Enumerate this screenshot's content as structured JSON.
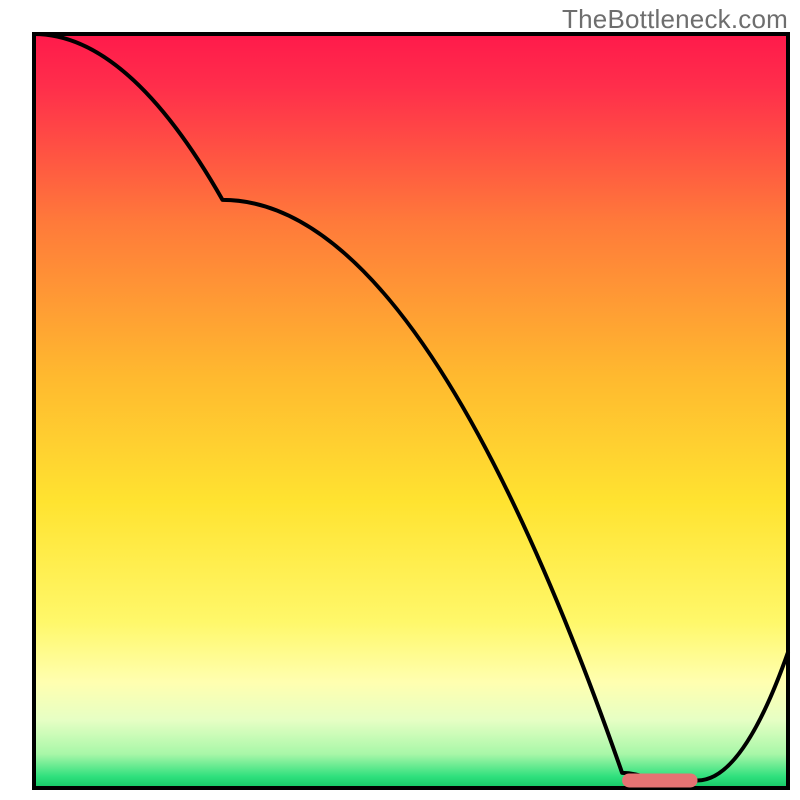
{
  "watermark": "TheBottleneck.com",
  "chart_data": {
    "type": "line",
    "title": "",
    "xlabel": "",
    "ylabel": "",
    "xlim": [
      0,
      100
    ],
    "ylim": [
      0,
      100
    ],
    "x": [
      0,
      25,
      78,
      82,
      88,
      100
    ],
    "values": [
      100,
      78,
      2,
      1,
      1,
      18
    ],
    "marker": {
      "x_start": 78,
      "x_end": 88,
      "y": 1
    },
    "gradient_stops": [
      {
        "offset": 0,
        "color": "#ff1a4b"
      },
      {
        "offset": 0.07,
        "color": "#ff2e4b"
      },
      {
        "offset": 0.25,
        "color": "#ff7a3a"
      },
      {
        "offset": 0.45,
        "color": "#ffb82f"
      },
      {
        "offset": 0.62,
        "color": "#ffe330"
      },
      {
        "offset": 0.78,
        "color": "#fff86a"
      },
      {
        "offset": 0.86,
        "color": "#ffffb0"
      },
      {
        "offset": 0.91,
        "color": "#e6ffc4"
      },
      {
        "offset": 0.955,
        "color": "#a8f7a8"
      },
      {
        "offset": 0.985,
        "color": "#2fe07d"
      },
      {
        "offset": 1.0,
        "color": "#14c765"
      }
    ]
  }
}
